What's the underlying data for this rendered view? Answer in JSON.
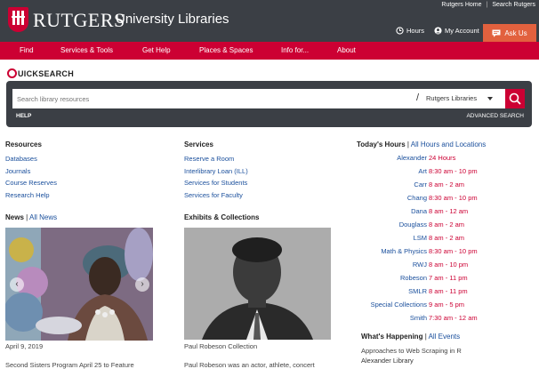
{
  "header": {
    "brand": "RUTGERS",
    "subtitle": "University Libraries",
    "top_links": [
      "Rutgers Home",
      "Search Rutgers"
    ],
    "hours_label": "Hours",
    "account_label": "My Account",
    "ask_label": "Ask Us"
  },
  "nav": [
    "Find",
    "Services & Tools",
    "Get Help",
    "Places & Spaces",
    "Info for...",
    "About"
  ],
  "quicksearch": {
    "logo_text": "uicksearch",
    "placeholder": "Search library resources",
    "scope": "Rutgers Libraries",
    "help": "HELP",
    "advanced": "ADVANCED SEARCH"
  },
  "resources": {
    "title": "Resources",
    "items": [
      "Databases",
      "Journals",
      "Course Reserves",
      "Research Help"
    ]
  },
  "services": {
    "title": "Services",
    "items": [
      "Reserve a Room",
      "Interlibrary Loan (ILL)",
      "Services for Students",
      "Services for Faculty"
    ]
  },
  "news": {
    "title": "News",
    "all_link": "All News",
    "date": "April 9, 2019",
    "caption": "Second Sisters Program April 25 to Feature"
  },
  "exhibits": {
    "title": "Exhibits & Collections",
    "image_label": "Paul Robeson Collection",
    "caption": "Paul Robeson was an actor, athlete, concert"
  },
  "hours": {
    "title": "Today's Hours",
    "all_link": "All Hours and Locations",
    "rows": [
      {
        "name": "Alexander",
        "time": "24 Hours"
      },
      {
        "name": "Art",
        "time": "8:30 am - 10 pm"
      },
      {
        "name": "Carr",
        "time": "8 am - 2 am"
      },
      {
        "name": "Chang",
        "time": "8:30 am - 10 pm"
      },
      {
        "name": "Dana",
        "time": "8 am - 12 am"
      },
      {
        "name": "Douglass",
        "time": "8 am - 2 am"
      },
      {
        "name": "LSM",
        "time": "8 am - 2 am"
      },
      {
        "name": "Math & Physics",
        "time": "8:30 am - 10 pm"
      },
      {
        "name": "RWJ",
        "time": "8 am - 10 pm"
      },
      {
        "name": "Robeson",
        "time": "7 am - 11 pm"
      },
      {
        "name": "SMLR",
        "time": "8 am - 11 pm"
      },
      {
        "name": "Special Collections",
        "time": "9 am - 5 pm"
      },
      {
        "name": "Smith",
        "time": "7:30 am - 12 am"
      }
    ]
  },
  "happening": {
    "title": "What's Happening",
    "all_link": "All Events",
    "event": "Approaches to Web Scraping in R",
    "location": "Alexander Library"
  },
  "colors": {
    "header_bg": "#3b3f45",
    "nav_bg": "#cc0033",
    "accent_red": "#cc0033",
    "ask_orange": "#e2613e",
    "link_blue": "#1a4f9c"
  }
}
